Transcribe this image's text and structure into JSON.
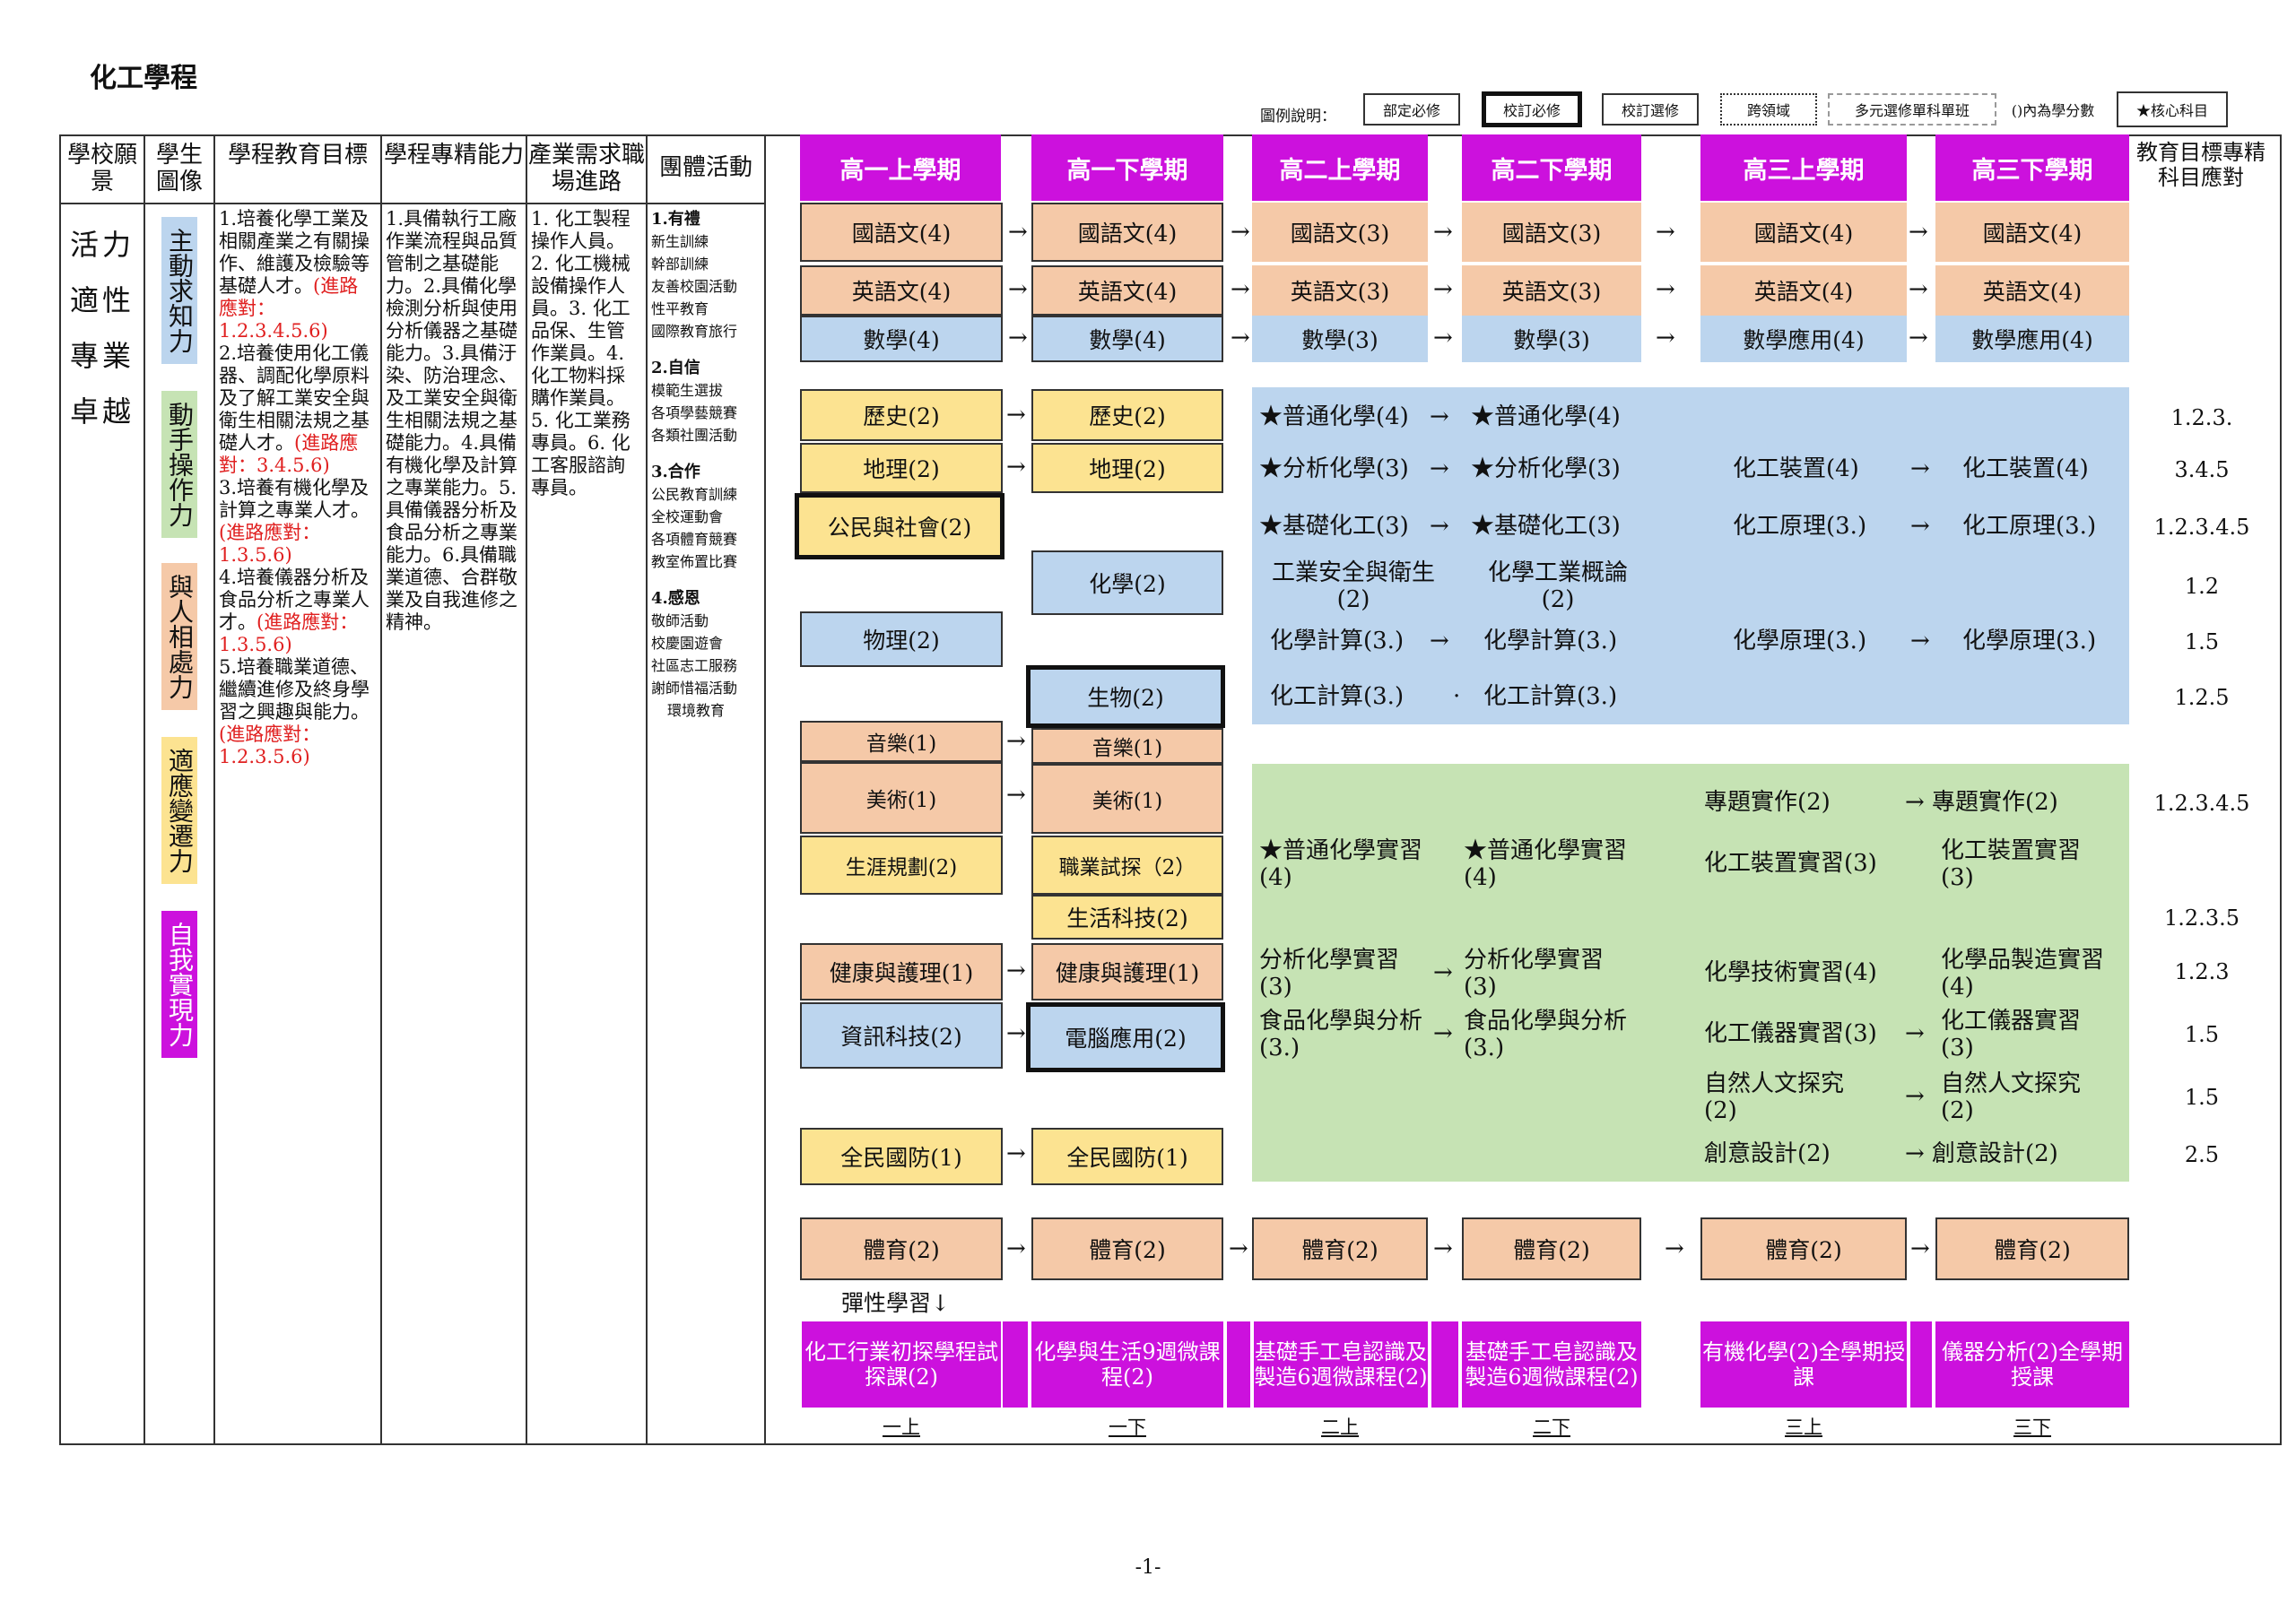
{
  "page_title": "化工學程",
  "legend": {
    "label": "圖例說明：",
    "items": [
      "部定必修",
      "校訂必修",
      "校訂選修",
      "跨領域",
      "多元選修單科單班",
      "()內為學分數",
      "★核心科目"
    ]
  },
  "headers": [
    "學校願景",
    "學生圖像",
    "學程教育目標",
    "學程專精能力",
    "產業需求職場進路",
    "團體活動"
  ],
  "vision": [
    "活力",
    "適性",
    "專業",
    "卓越"
  ],
  "traits": [
    "主動求知力",
    "動手操作力",
    "與人相處力",
    "適應變遷力",
    "自我實現力"
  ],
  "goals": [
    {
      "text": "1.培養化學工業及相關產業之有關操作、維護及檢驗等基礎人才。",
      "map": "(進路應對：1.2.3.4.5.6)"
    },
    {
      "text": "2.培養使用化工儀器、調配化學原料及了解工業安全與衛生相關法規之基礎人才。",
      "map": "(進路應對：3.4.5.6)"
    },
    {
      "text": "3.培養有機化學及計算之專業人才。",
      "map": "(進路應對：1.3.5.6)"
    },
    {
      "text": "4.培養儀器分析及食品分析之專業人才。",
      "map": "(進路應對：1.3.5.6)"
    },
    {
      "text": "5.培養職業道德、繼續進修及終身學習之興趣與能力。",
      "map": "(進路應對：1.2.3.5.6)"
    }
  ],
  "abilities": "1.具備執行工廠作業流程與品質管制之基礎能力。2.具備化學檢測分析與使用分析儀器之基礎能力。3.具備汙染、防治理念、及工業安全與衛生相關法規之基礎能力。4.具備有機化學及計算之專業能力。5.具備儀器分析及食品分析之專業能力。6.具備職業道德、合群敬業及自我進修之精神。",
  "careers": "1. 化工製程操作人員。2. 化工機械設備操作人員。3. 化工品保、生管作業員。4. 化工物料採購作業員。5. 化工業務專員。6. 化工客服諮詢專員。",
  "activities": [
    {
      "head": "1.有禮",
      "items": [
        "新生訓練",
        "幹部訓練",
        "友善校園活動",
        "性平教育",
        "國際教育旅行"
      ]
    },
    {
      "head": "2.自信",
      "items": [
        "模範生選拔",
        "各項學藝競賽",
        "各類社團活動"
      ]
    },
    {
      "head": "3.合作",
      "items": [
        "公民教育訓練",
        "全校運動會",
        "各項體育競賽",
        "教室佈置比賽"
      ]
    },
    {
      "head": "4.感恩",
      "items": [
        "敬師活動",
        "校慶園遊會",
        "社區志工服務",
        "謝師惜福活動",
        "環境教育"
      ]
    }
  ],
  "semesters": [
    "高一上學期",
    "高一下學期",
    "高二上學期",
    "高二下學期",
    "高三上學期",
    "高三下學期"
  ],
  "target_header": "教育目標專精科目應對",
  "arrow": "→",
  "row_chinese": [
    "國語文(4)",
    "國語文(4)",
    "國語文(3)",
    "國語文(3)",
    "國語文(4)",
    "國語文(4)"
  ],
  "row_english": [
    "英語文(4)",
    "英語文(4)",
    "英語文(3)",
    "英語文(3)",
    "英語文(4)",
    "英語文(4)"
  ],
  "row_math": [
    "數學(4)",
    "數學(4)",
    "數學(3)",
    "數學(3)",
    "數學應用(4)",
    "數學應用(4)"
  ],
  "g1": {
    "history": "歷史(2)",
    "history2": "歷史(2)",
    "geo": "地理(2)",
    "geo2": "地理(2)",
    "civic": "公民與社會(2)",
    "chem": "化學(2)",
    "phys": "物理(2)",
    "bio": "生物(2)",
    "music": "音樂(1)",
    "music2": "音樂(1)",
    "art": "美術(1)",
    "art2": "美術(1)",
    "career": "生涯規劃(2)",
    "trial": "職業試探（2）",
    "tech": "生活科技(2)",
    "health": "健康與護理(1)",
    "health2": "健康與護理(1)",
    "it": "資訊科技(2)",
    "comp": "電腦應用(2)",
    "defense": "全民國防(1)",
    "defense2": "全民國防(1)"
  },
  "pe": [
    "體育(2)",
    "體育(2)",
    "體育(2)",
    "體育(2)",
    "體育(2)",
    "體育(2)"
  ],
  "blue_panel": {
    "r1": [
      "★普通化學(4)",
      "★普通化學(4)"
    ],
    "r2": [
      "★分析化學(3)",
      "★分析化學(3)",
      "化工裝置(4)",
      "化工裝置(4)"
    ],
    "r3": [
      "★基礎化工(3)",
      "★基礎化工(3)",
      "化工原理(3.)",
      "化工原理(3.)"
    ],
    "r4": [
      "工業安全與衛生(2)",
      "化學工業概論(2)"
    ],
    "r5": [
      "化學計算(3.)",
      "化學計算(3.)",
      "化學原理(3.)",
      "化學原理(3.)"
    ],
    "r6": [
      "化工計算(3.)",
      "·",
      "化工計算(3.)"
    ]
  },
  "green_panel": {
    "r1": [
      "專題實作(2)",
      "專題實作(2)"
    ],
    "r2": [
      "★普通化學實習(4)",
      "★普通化學實習(4)",
      "化工裝置實習(3)",
      "化工裝置實習(3)"
    ],
    "r3": [
      "分析化學實習(3)",
      "分析化學實習(3)",
      "化學技術實習(4)",
      "化學品製造實習(4)"
    ],
    "r4": [
      "食品化學與分析(3.)",
      "食品化學與分析(3.)",
      "化工儀器實習(3)",
      "化工儀器實習(3)"
    ],
    "r5": [
      "自然人文探究(2)",
      "自然人文探究(2)"
    ],
    "r6": [
      "創意設計(2)",
      "創意設計(2)"
    ]
  },
  "targets": [
    "1.2.3.",
    "3.4.5",
    "1.2.3.4.5",
    "1.2",
    "1.5",
    "1.2.5",
    "1.2.3.4.5",
    "1.2.3.5",
    "1.2.3",
    "1.5",
    "1.5",
    "2.5"
  ],
  "flex_label": "彈性學習↓",
  "flex": [
    "化工行業初探學程試探課(2)",
    "化學與生活9週微課程(2)",
    "基礎手工皂認識及製造6週微課程(2)",
    "基礎手工皂認識及製造6週微課程(2)",
    "有機化學(2)全學期授課",
    "儀器分析(2)全學期授課"
  ],
  "sem_short": [
    "一上",
    "一下",
    "二上",
    "二下",
    "三上",
    "三下"
  ],
  "page_number": "-1-",
  "colors": {
    "semester": "#cc11dd",
    "pink": "#f5c9a8",
    "blue": "#bcd5ee",
    "yellow": "#fce391",
    "green": "#c6e3b4"
  }
}
